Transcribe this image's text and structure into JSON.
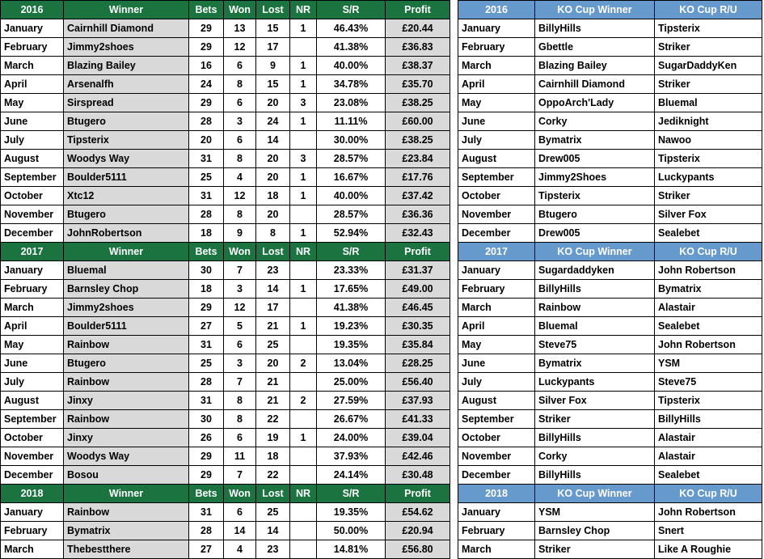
{
  "left": {
    "headers_year": [
      "2016",
      "2017",
      "2018"
    ],
    "headers": [
      "Winner",
      "Bets",
      "Won",
      "Lost",
      "NR",
      "S/R",
      "Profit"
    ],
    "sections": [
      {
        "year": "2016",
        "rows": [
          {
            "month": "January",
            "winner": "Cairnhill Diamond",
            "bets": "29",
            "won": "13",
            "lost": "15",
            "nr": "1",
            "sr": "46.43%",
            "profit": "£20.44"
          },
          {
            "month": "February",
            "winner": "Jimmy2shoes",
            "bets": "29",
            "won": "12",
            "lost": "17",
            "nr": "",
            "sr": "41.38%",
            "profit": "£36.83"
          },
          {
            "month": "March",
            "winner": "Blazing Bailey",
            "bets": "16",
            "won": "6",
            "lost": "9",
            "nr": "1",
            "sr": "40.00%",
            "profit": "£38.37"
          },
          {
            "month": "April",
            "winner": "Arsenalfh",
            "bets": "24",
            "won": "8",
            "lost": "15",
            "nr": "1",
            "sr": "34.78%",
            "profit": "£35.70"
          },
          {
            "month": "May",
            "winner": "Sirspread",
            "bets": "29",
            "won": "6",
            "lost": "20",
            "nr": "3",
            "sr": "23.08%",
            "profit": "£38.25"
          },
          {
            "month": "June",
            "winner": "Btugero",
            "bets": "28",
            "won": "3",
            "lost": "24",
            "nr": "1",
            "sr": "11.11%",
            "profit": "£60.00"
          },
          {
            "month": "July",
            "winner": "Tipsterix",
            "bets": "20",
            "won": "6",
            "lost": "14",
            "nr": "",
            "sr": "30.00%",
            "profit": "£38.25"
          },
          {
            "month": "August",
            "winner": "Woodys Way",
            "bets": "31",
            "won": "8",
            "lost": "20",
            "nr": "3",
            "sr": "28.57%",
            "profit": "£23.84"
          },
          {
            "month": "September",
            "winner": "Boulder5111",
            "bets": "25",
            "won": "4",
            "lost": "20",
            "nr": "1",
            "sr": "16.67%",
            "profit": "£17.76"
          },
          {
            "month": "October",
            "winner": "Xtc12",
            "bets": "31",
            "won": "12",
            "lost": "18",
            "nr": "1",
            "sr": "40.00%",
            "profit": "£37.42"
          },
          {
            "month": "November",
            "winner": "Btugero",
            "bets": "28",
            "won": "8",
            "lost": "20",
            "nr": "",
            "sr": "28.57%",
            "profit": "£36.36"
          },
          {
            "month": "December",
            "winner": "JohnRobertson",
            "bets": "18",
            "won": "9",
            "lost": "8",
            "nr": "1",
            "sr": "52.94%",
            "profit": "£32.43"
          }
        ]
      },
      {
        "year": "2017",
        "rows": [
          {
            "month": "January",
            "winner": "Bluemal",
            "bets": "30",
            "won": "7",
            "lost": "23",
            "nr": "",
            "sr": "23.33%",
            "profit": "£31.37"
          },
          {
            "month": "February",
            "winner": "Barnsley Chop",
            "bets": "18",
            "won": "3",
            "lost": "14",
            "nr": "1",
            "sr": "17.65%",
            "profit": "£49.00"
          },
          {
            "month": "March",
            "winner": "Jimmy2shoes",
            "bets": "29",
            "won": "12",
            "lost": "17",
            "nr": "",
            "sr": "41.38%",
            "profit": "£46.45"
          },
          {
            "month": "April",
            "winner": "Boulder5111",
            "bets": "27",
            "won": "5",
            "lost": "21",
            "nr": "1",
            "sr": "19.23%",
            "profit": "£30.35"
          },
          {
            "month": "May",
            "winner": "Rainbow",
            "bets": "31",
            "won": "6",
            "lost": "25",
            "nr": "",
            "sr": "19.35%",
            "profit": "£35.84"
          },
          {
            "month": "June",
            "winner": "Btugero",
            "bets": "25",
            "won": "3",
            "lost": "20",
            "nr": "2",
            "sr": "13.04%",
            "profit": "£28.25"
          },
          {
            "month": "July",
            "winner": "Rainbow",
            "bets": "28",
            "won": "7",
            "lost": "21",
            "nr": "",
            "sr": "25.00%",
            "profit": "£56.40"
          },
          {
            "month": "August",
            "winner": "Jinxy",
            "bets": "31",
            "won": "8",
            "lost": "21",
            "nr": "2",
            "sr": "27.59%",
            "profit": "£37.93"
          },
          {
            "month": "September",
            "winner": "Rainbow",
            "bets": "30",
            "won": "8",
            "lost": "22",
            "nr": "",
            "sr": "26.67%",
            "profit": "£41.33"
          },
          {
            "month": "October",
            "winner": "Jinxy",
            "bets": "26",
            "won": "6",
            "lost": "19",
            "nr": "1",
            "sr": "24.00%",
            "profit": "£39.04"
          },
          {
            "month": "November",
            "winner": "Woodys Way",
            "bets": "29",
            "won": "11",
            "lost": "18",
            "nr": "",
            "sr": "37.93%",
            "profit": "£42.46"
          },
          {
            "month": "December",
            "winner": "Bosou",
            "bets": "29",
            "won": "7",
            "lost": "22",
            "nr": "",
            "sr": "24.14%",
            "profit": "£30.48"
          }
        ]
      },
      {
        "year": "2018",
        "rows": [
          {
            "month": "January",
            "winner": "Rainbow",
            "bets": "31",
            "won": "6",
            "lost": "25",
            "nr": "",
            "sr": "19.35%",
            "profit": "£54.62"
          },
          {
            "month": "February",
            "winner": "Bymatrix",
            "bets": "28",
            "won": "14",
            "lost": "14",
            "nr": "",
            "sr": "50.00%",
            "profit": "£20.94"
          },
          {
            "month": "March",
            "winner": "Thebestthere",
            "bets": "27",
            "won": "4",
            "lost": "23",
            "nr": "",
            "sr": "14.81%",
            "profit": "£56.80"
          }
        ]
      }
    ]
  },
  "right": {
    "headers": [
      "KO Cup Winner",
      "KO Cup R/U"
    ],
    "sections": [
      {
        "year": "2016",
        "rows": [
          {
            "month": "January",
            "winner": "BillyHills",
            "ru": "Tipsterix"
          },
          {
            "month": "February",
            "winner": "Gbettle",
            "ru": "Striker"
          },
          {
            "month": "March",
            "winner": "Blazing Bailey",
            "ru": "SugarDaddyKen"
          },
          {
            "month": "April",
            "winner": "Cairnhill Diamond",
            "ru": "Striker"
          },
          {
            "month": "May",
            "winner": "OppoArch'Lady",
            "ru": "Bluemal"
          },
          {
            "month": "June",
            "winner": "Corky",
            "ru": "Jediknight"
          },
          {
            "month": "July",
            "winner": "Bymatrix",
            "ru": "Nawoo"
          },
          {
            "month": "August",
            "winner": "Drew005",
            "ru": "Tipsterix"
          },
          {
            "month": "September",
            "winner": "Jimmy2Shoes",
            "ru": "Luckypants"
          },
          {
            "month": "October",
            "winner": "Tipsterix",
            "ru": "Striker"
          },
          {
            "month": "November",
            "winner": "Btugero",
            "ru": "Silver Fox"
          },
          {
            "month": "December",
            "winner": "Drew005",
            "ru": "Sealebet"
          }
        ]
      },
      {
        "year": "2017",
        "rows": [
          {
            "month": "January",
            "winner": "Sugardaddyken",
            "ru": "John Robertson"
          },
          {
            "month": "February",
            "winner": "BillyHills",
            "ru": "Bymatrix"
          },
          {
            "month": "March",
            "winner": "Rainbow",
            "ru": "Alastair"
          },
          {
            "month": "April",
            "winner": "Bluemal",
            "ru": "Sealebet"
          },
          {
            "month": "May",
            "winner": "Steve75",
            "ru": "John Robertson"
          },
          {
            "month": "June",
            "winner": "Bymatrix",
            "ru": "YSM"
          },
          {
            "month": "July",
            "winner": "Luckypants",
            "ru": "Steve75"
          },
          {
            "month": "August",
            "winner": "Silver Fox",
            "ru": "Tipsterix"
          },
          {
            "month": "September",
            "winner": "Striker",
            "ru": "BillyHills"
          },
          {
            "month": "October",
            "winner": "BillyHills",
            "ru": "Alastair"
          },
          {
            "month": "November",
            "winner": "Corky",
            "ru": "Alastair"
          },
          {
            "month": "December",
            "winner": "BillyHills",
            "ru": "Sealebet"
          }
        ]
      },
      {
        "year": "2018",
        "rows": [
          {
            "month": "January",
            "winner": "YSM",
            "ru": "John Robertson"
          },
          {
            "month": "February",
            "winner": "Barnsley Chop",
            "ru": "Snert"
          },
          {
            "month": "March",
            "winner": "Striker",
            "ru": "Like A Roughie"
          }
        ]
      }
    ]
  },
  "colors": {
    "header_green": "#1b7340",
    "header_blue": "#6699cc",
    "shaded_cell": "#d9d9d9"
  }
}
